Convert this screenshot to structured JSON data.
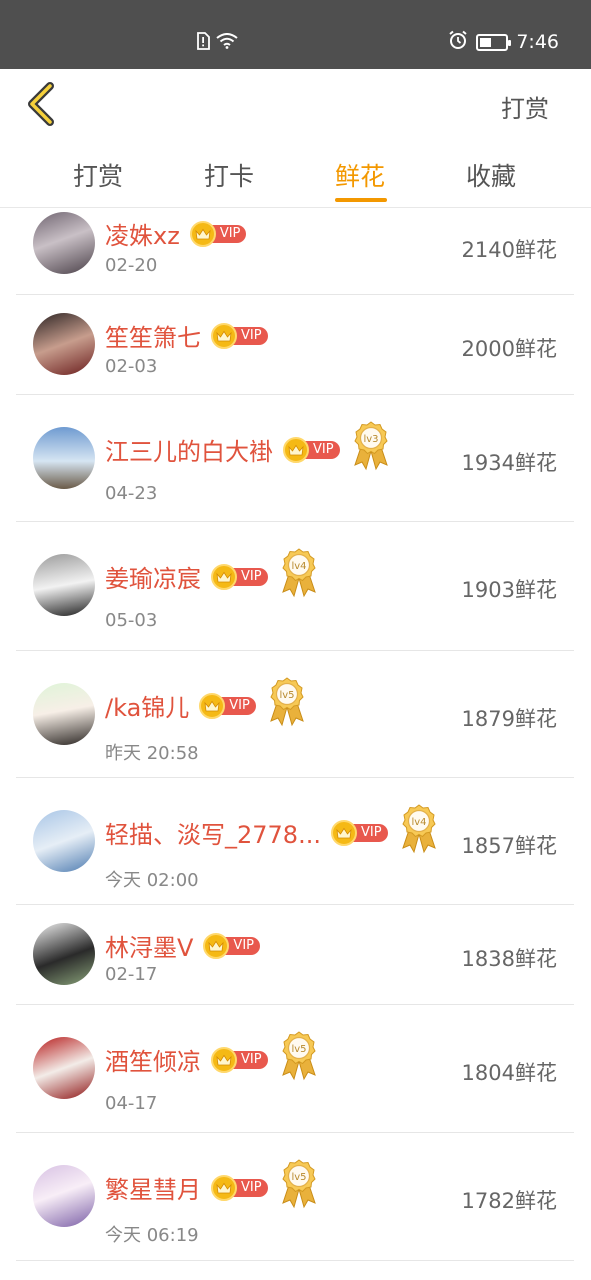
{
  "status_bar": {
    "time": "7:46",
    "battery_level": 0.45
  },
  "header": {
    "action_label": "打赏"
  },
  "tabs": [
    {
      "label": "打赏",
      "active": false
    },
    {
      "label": "打卡",
      "active": false
    },
    {
      "label": "鲜花",
      "active": true
    },
    {
      "label": "收藏",
      "active": false
    }
  ],
  "colors": {
    "accent": "#f39800",
    "name": "#e0533d",
    "vip": "#e8584d",
    "badge_gold": "#e9b13b"
  },
  "rows": [
    {
      "name": "凌姝xz",
      "vip": "VIP",
      "level": "",
      "date": "02-20",
      "amount": "2140鲜花"
    },
    {
      "name": "笙笙箫七",
      "vip": "VIP",
      "level": "",
      "date": "02-03",
      "amount": "2000鲜花"
    },
    {
      "name": "江三儿的白大褂",
      "vip": "VIP",
      "level": "lv3",
      "date": "04-23",
      "amount": "1934鲜花"
    },
    {
      "name": "姜瑜凉宸",
      "vip": "VIP",
      "level": "lv4",
      "date": "05-03",
      "amount": "1903鲜花"
    },
    {
      "name": "/ka锦儿",
      "vip": "VIP",
      "level": "lv5",
      "date": "昨天 20:58",
      "amount": "1879鲜花"
    },
    {
      "name": "轻描、淡写_2778...",
      "vip": "VIP",
      "level": "lv4",
      "date": "今天 02:00",
      "amount": "1857鲜花"
    },
    {
      "name": "林浔墨V",
      "vip": "VIP",
      "level": "",
      "date": "02-17",
      "amount": "1838鲜花"
    },
    {
      "name": "酒笙倾凉",
      "vip": "VIP",
      "level": "lv5",
      "date": "04-17",
      "amount": "1804鲜花"
    },
    {
      "name": "繁星彗月",
      "vip": "VIP",
      "level": "lv5",
      "date": "今天 06:19",
      "amount": "1782鲜花"
    }
  ]
}
